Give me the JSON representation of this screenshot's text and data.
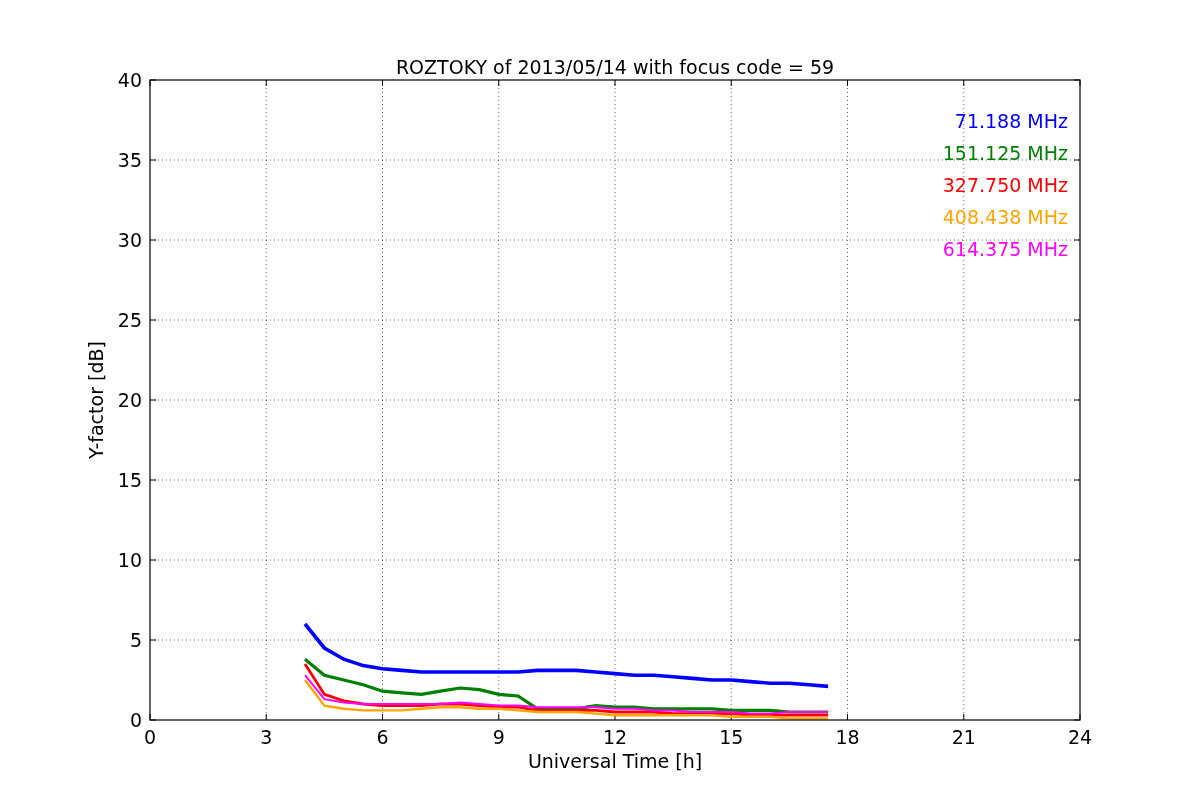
{
  "chart_data": {
    "type": "line",
    "title": "ROZTOKY of 2013/05/14 with focus code = 59",
    "xlabel": "Universal Time [h]",
    "ylabel": "Y-factor [dB]",
    "x": [
      4,
      4.5,
      5,
      5.5,
      6,
      6.5,
      7,
      7.5,
      8,
      8.5,
      9,
      9.5,
      10,
      10.5,
      11,
      11.5,
      12,
      12.5,
      13,
      13.5,
      14,
      14.5,
      15,
      15.5,
      16,
      16.5,
      17,
      17.5
    ],
    "series": [
      {
        "name": "71.188 MHz",
        "color": "#0000ff",
        "values": [
          6,
          4.5,
          3.8,
          3.4,
          3.2,
          3.1,
          3.0,
          3.0,
          3.0,
          3.0,
          3.0,
          3.0,
          3.1,
          3.1,
          3.1,
          3.0,
          2.9,
          2.8,
          2.8,
          2.7,
          2.6,
          2.5,
          2.5,
          2.4,
          2.3,
          2.3,
          2.2,
          2.1
        ]
      },
      {
        "name": "151.125 MHz",
        "color": "#008000",
        "values": [
          3.8,
          2.8,
          2.5,
          2.2,
          1.8,
          1.7,
          1.6,
          1.8,
          2.0,
          1.9,
          1.6,
          1.5,
          0.7,
          0.7,
          0.7,
          0.9,
          0.8,
          0.8,
          0.7,
          0.7,
          0.7,
          0.7,
          0.6,
          0.6,
          0.6,
          0.5,
          0.5,
          0.5
        ]
      },
      {
        "name": "327.750 MHz",
        "color": "#ff0000",
        "values": [
          3.5,
          1.6,
          1.2,
          1.0,
          0.9,
          0.9,
          0.9,
          1.0,
          1.0,
          0.9,
          0.8,
          0.8,
          0.6,
          0.6,
          0.6,
          0.6,
          0.5,
          0.5,
          0.5,
          0.4,
          0.4,
          0.4,
          0.4,
          0.3,
          0.3,
          0.3,
          0.3,
          0.3
        ]
      },
      {
        "name": "408.438 MHz",
        "color": "#ffa500",
        "values": [
          2.5,
          0.9,
          0.7,
          0.6,
          0.6,
          0.6,
          0.7,
          0.8,
          0.8,
          0.7,
          0.7,
          0.6,
          0.5,
          0.5,
          0.5,
          0.4,
          0.3,
          0.3,
          0.3,
          0.3,
          0.3,
          0.3,
          0.2,
          0.2,
          0.2,
          0.1,
          0.1,
          0.1
        ]
      },
      {
        "name": "614.375 MHz",
        "color": "#ff00ff",
        "values": [
          2.8,
          1.3,
          1.1,
          1.0,
          1.0,
          1.0,
          1.0,
          1.0,
          1.1,
          1.0,
          0.9,
          0.9,
          0.8,
          0.8,
          0.8,
          0.8,
          0.7,
          0.7,
          0.6,
          0.6,
          0.5,
          0.5,
          0.5,
          0.4,
          0.4,
          0.5,
          0.5,
          0.5
        ]
      }
    ],
    "xlim": [
      0,
      24
    ],
    "ylim": [
      0,
      40
    ],
    "xticks": [
      0,
      3,
      6,
      9,
      12,
      15,
      18,
      21,
      24
    ],
    "yticks": [
      0,
      5,
      10,
      15,
      20,
      25,
      30,
      35,
      40
    ],
    "grid": true
  }
}
